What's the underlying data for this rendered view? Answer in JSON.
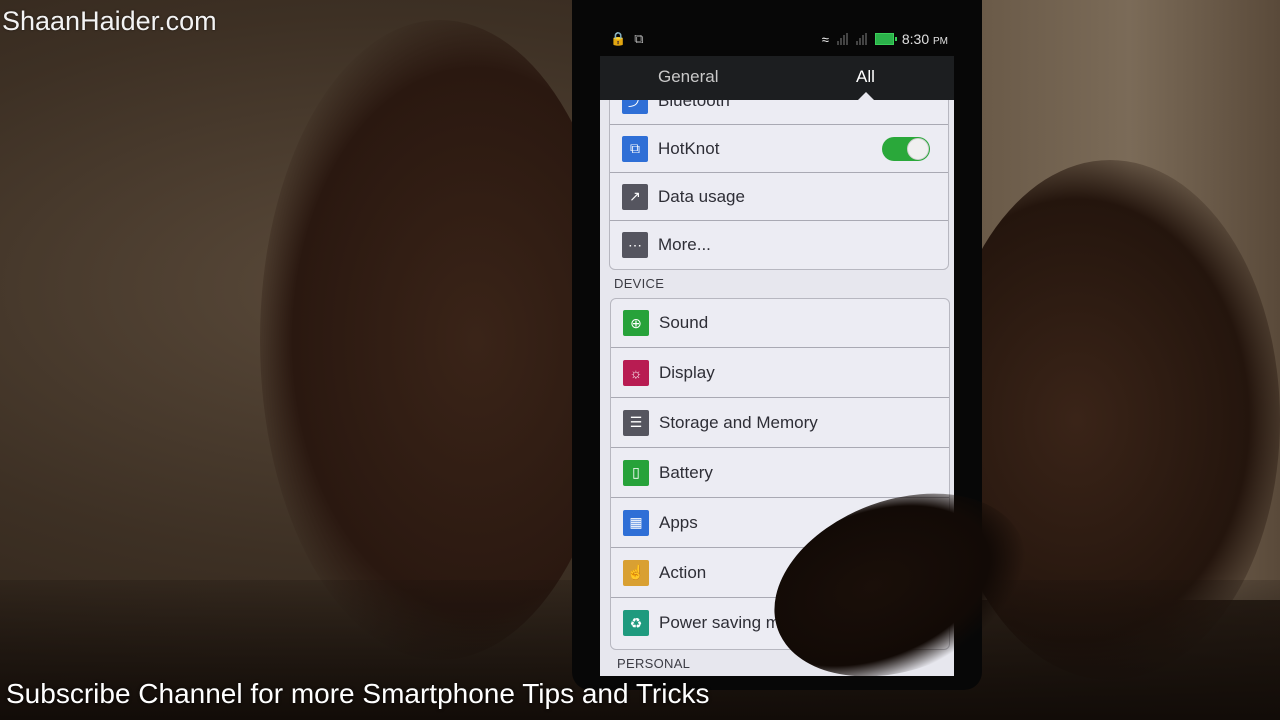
{
  "overlay": {
    "watermark": "ShaanHaider.com",
    "caption": "Subscribe Channel for more Smartphone Tips and Tricks"
  },
  "statusbar": {
    "icons_left": [
      "lock-icon",
      "hotknot-icon"
    ],
    "icons_right": [
      "wifi-icon",
      "signal-icon",
      "signal-icon",
      "battery-icon"
    ],
    "time": "8:30",
    "ampm": "PM"
  },
  "tabs": [
    {
      "label": "General",
      "active": false
    },
    {
      "label": "All",
      "active": true
    }
  ],
  "wireless": {
    "items": [
      {
        "label": "Bluetooth",
        "icon": "bluetooth-icon",
        "color": "#2f6fd6"
      },
      {
        "label": "HotKnot",
        "icon": "hotknot-icon",
        "color": "#2f6fd6",
        "toggle": true
      },
      {
        "label": "Data usage",
        "icon": "data-usage-icon",
        "color": "#55555f"
      },
      {
        "label": "More...",
        "icon": "more-icon",
        "color": "#55555f"
      }
    ]
  },
  "device": {
    "header": "DEVICE",
    "items": [
      {
        "label": "Sound",
        "icon": "sound-icon",
        "color": "#27a23a"
      },
      {
        "label": "Display",
        "icon": "display-icon",
        "color": "#b81c52"
      },
      {
        "label": "Storage and Memory",
        "icon": "storage-icon",
        "color": "#55555f"
      },
      {
        "label": "Battery",
        "icon": "battery-icon",
        "color": "#27a23a"
      },
      {
        "label": "Apps",
        "icon": "apps-icon",
        "color": "#2f6fd6"
      },
      {
        "label": "Action",
        "icon": "action-icon",
        "color": "#d9a032"
      },
      {
        "label": "Power saving manager",
        "icon": "power-saving-icon",
        "color": "#1f9a7e"
      }
    ]
  },
  "personal": {
    "header": "PERSONAL"
  }
}
